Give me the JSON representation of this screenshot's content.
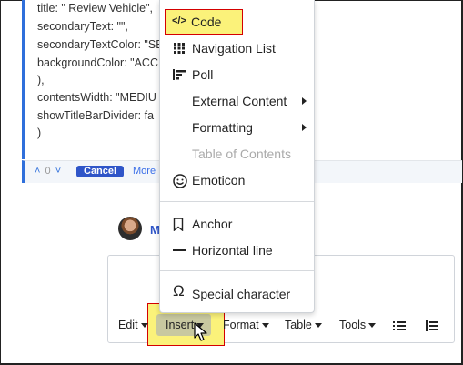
{
  "code_lines": [
    "title: \" Review Vehicle\",",
    "secondaryText: \"\",",
    "secondaryTextColor: \"SE",
    "backgroundColor: \"ACC",
    "),",
    "contentsWidth: \"MEDIU",
    "showTitleBarDivider: fa",
    ")"
  ],
  "actions": {
    "vote_count": "0",
    "cancel_label": "Cancel",
    "more_label": "More"
  },
  "author": {
    "initial": "M"
  },
  "toolbar": {
    "edit": "Edit",
    "insert": "Insert",
    "format": "Format",
    "table": "Table",
    "tools": "Tools"
  },
  "menu": {
    "code": "Code",
    "navigation_list": "Navigation List",
    "poll": "Poll",
    "external_content": "External Content",
    "formatting": "Formatting",
    "table_of_contents": "Table of Contents",
    "emoticon": "Emoticon",
    "anchor": "Anchor",
    "horizontal_line": "Horizontal line",
    "special_character": "Special character"
  },
  "colors": {
    "accent": "#2f6fdb",
    "highlight": "#fbf27a",
    "highlight_border": "#d40000",
    "cancel_bg": "#2f55c8"
  }
}
